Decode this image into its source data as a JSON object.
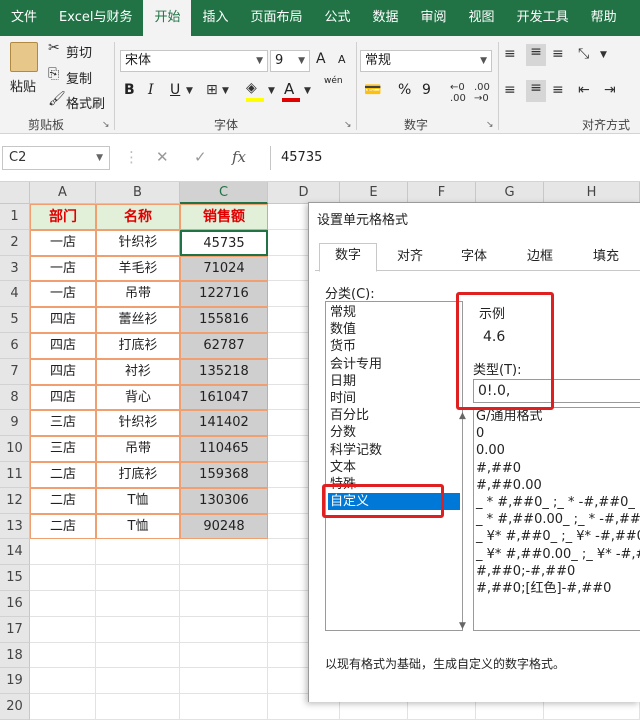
{
  "ribbon_tabs": [
    "文件",
    "Excel与财务",
    "开始",
    "插入",
    "页面布局",
    "公式",
    "数据",
    "审阅",
    "视图",
    "开发工具",
    "帮助"
  ],
  "active_tab_index": 2,
  "clipboard": {
    "paste": "粘贴",
    "cut": "剪切",
    "copy": "复制",
    "format_painter": "格式刷",
    "group_label": "剪贴板"
  },
  "font": {
    "name": "宋体",
    "size": "9",
    "bold": "B",
    "italic": "I",
    "underline": "U",
    "group_label": "字体",
    "grow": "A",
    "shrink": "A",
    "phonetic": "wén",
    "font_color_letter": "A"
  },
  "number": {
    "format": "常规",
    "group_label": "数字",
    "percent": "%",
    "comma": "9"
  },
  "alignment": {
    "group_label": "对齐方式"
  },
  "formula_bar": {
    "name_box": "C2",
    "fx": "fx",
    "value": "45735"
  },
  "columns": [
    "A",
    "B",
    "C",
    "D",
    "E",
    "F",
    "G",
    "H"
  ],
  "rows": [
    "1",
    "2",
    "3",
    "4",
    "5",
    "6",
    "7",
    "8",
    "9",
    "10",
    "11",
    "12",
    "13",
    "14",
    "15",
    "16",
    "17",
    "18",
    "19",
    "20"
  ],
  "table": {
    "headers": [
      "部门",
      "名称",
      "销售额"
    ],
    "rows": [
      [
        "一店",
        "针织衫",
        "45735"
      ],
      [
        "一店",
        "羊毛衫",
        "71024"
      ],
      [
        "一店",
        "吊带",
        "122716"
      ],
      [
        "四店",
        "蕾丝衫",
        "155816"
      ],
      [
        "四店",
        "打底衫",
        "62787"
      ],
      [
        "四店",
        "衬衫",
        "135218"
      ],
      [
        "四店",
        "背心",
        "161047"
      ],
      [
        "三店",
        "针织衫",
        "141402"
      ],
      [
        "三店",
        "吊带",
        "110465"
      ],
      [
        "二店",
        "打底衫",
        "159368"
      ],
      [
        "二店",
        "T恤",
        "130306"
      ],
      [
        "二店",
        "T恤",
        "90248"
      ]
    ]
  },
  "dialog": {
    "title": "设置单元格格式",
    "tabs": [
      "数字",
      "对齐",
      "字体",
      "边框",
      "填充"
    ],
    "category_label": "分类(C):",
    "categories": [
      "常规",
      "数值",
      "货币",
      "会计专用",
      "日期",
      "时间",
      "百分比",
      "分数",
      "科学记数",
      "文本",
      "特殊",
      "自定义"
    ],
    "selected_category": "自定义",
    "sample_label": "示例",
    "sample_value": "4.6",
    "type_label": "类型(T):",
    "type_value": "0!.0,",
    "formats": [
      "G/通用格式",
      "0",
      "0.00",
      "#,##0",
      "#,##0.00",
      "_ * #,##0_ ;_ * -#,##0_ ;_ * \"",
      "_ * #,##0.00_ ;_ * -#,##0.00",
      "_ ¥* #,##0_ ;_ ¥* -#,##0_ ;",
      "_ ¥* #,##0.00_ ;_ ¥* -#,##0",
      "#,##0;-#,##0",
      "#,##0;[红色]-#,##0"
    ],
    "description": "以现有格式为基础，生成自定义的数字格式。"
  },
  "colors": {
    "excel_green": "#217346",
    "header_red": "#e00000",
    "header_fill": "#e2efd9",
    "selection_blue": "#0078d7",
    "annotation_red": "#e02020",
    "table_border": "#f0a070"
  }
}
